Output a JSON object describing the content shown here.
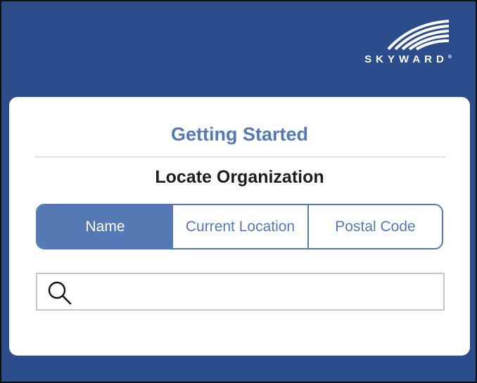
{
  "header": {
    "logo_text": "SKYWARD",
    "logo_mark": "®",
    "logo_icon": "skyward-swoosh-icon",
    "background_color": "#2c4d8c"
  },
  "card": {
    "title": "Getting Started",
    "subtitle": "Locate Organization",
    "tabs": [
      {
        "label": "Name",
        "selected": true
      },
      {
        "label": "Current Location",
        "selected": false
      },
      {
        "label": "Postal Code",
        "selected": false
      }
    ],
    "search": {
      "icon": "search-icon",
      "value": "",
      "placeholder": ""
    },
    "accent_color": "#5579b5"
  }
}
